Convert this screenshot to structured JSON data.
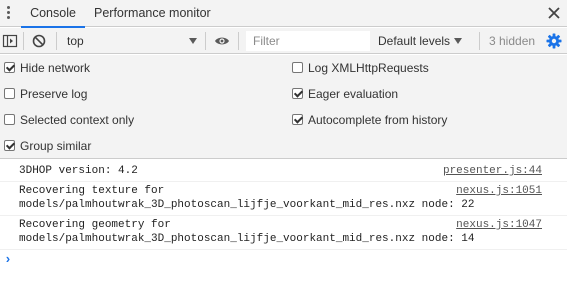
{
  "tabs": [
    {
      "label": "Console",
      "active": true
    },
    {
      "label": "Performance monitor",
      "active": false
    }
  ],
  "toolbar": {
    "context": "top",
    "filter_placeholder": "Filter",
    "levels": "Default levels",
    "hidden_count": "3 hidden"
  },
  "settings": {
    "left": [
      {
        "label": "Hide network",
        "checked": true
      },
      {
        "label": "Preserve log",
        "checked": false
      },
      {
        "label": "Selected context only",
        "checked": false
      },
      {
        "label": "Group similar",
        "checked": true
      }
    ],
    "right": [
      {
        "label": "Log XMLHttpRequests",
        "checked": false
      },
      {
        "label": "Eager evaluation",
        "checked": true
      },
      {
        "label": "Autocomplete from history",
        "checked": true
      }
    ]
  },
  "messages": [
    {
      "lines": [
        "3DHOP version: 4.2"
      ],
      "source": "presenter.js:44"
    },
    {
      "lines": [
        "Recovering texture for",
        "models/palmhoutwrak_3D_photoscan_lijfje_voorkant_mid_res.nxz node: 22"
      ],
      "source": "nexus.js:1051"
    },
    {
      "lines": [
        "Recovering geometry for",
        "models/palmhoutwrak_3D_photoscan_lijfje_voorkant_mid_res.nxz node: 14"
      ],
      "source": "nexus.js:1047"
    }
  ],
  "prompt_symbol": "›",
  "colors": {
    "accent": "#1a73e8",
    "panel": "#f3f3f3",
    "border": "#cccccc"
  }
}
